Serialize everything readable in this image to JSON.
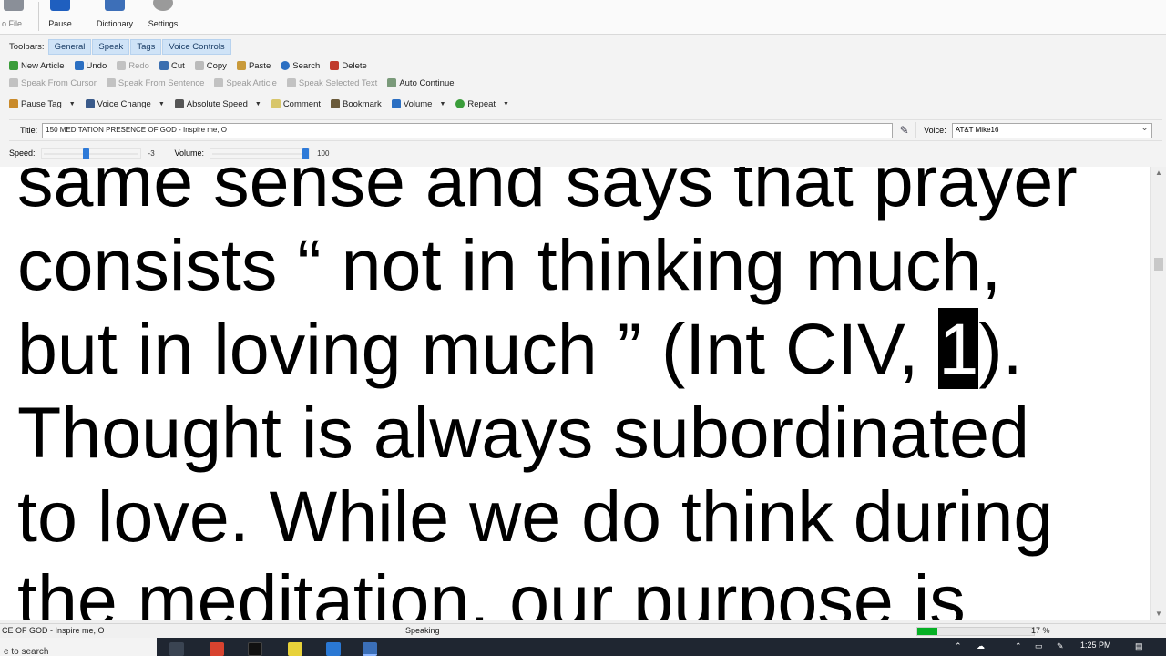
{
  "ribbon": {
    "items": [
      {
        "label": "o File",
        "icon": "save-icon"
      },
      {
        "label": "Pause",
        "icon": "pause-icon"
      },
      {
        "label": "Dictionary",
        "icon": "dictionary-icon"
      },
      {
        "label": "Settings",
        "icon": "gear-icon"
      }
    ]
  },
  "toolbars": {
    "label": "Toolbars:",
    "tabs": [
      "General",
      "Speak",
      "Tags",
      "Voice Controls"
    ],
    "row1": [
      {
        "label": "New Article",
        "icon": "new-article-icon",
        "color": "#3a9d3a"
      },
      {
        "label": "Undo",
        "icon": "undo-icon",
        "color": "#2b6fc2"
      },
      {
        "label": "Redo",
        "icon": "redo-icon",
        "color": "#888888",
        "disabled": true
      },
      {
        "label": "Cut",
        "icon": "scissors-icon",
        "color": "#3b6fb0"
      },
      {
        "label": "Copy",
        "icon": "copy-icon",
        "color": "#888888",
        "disabled": true
      },
      {
        "label": "Paste",
        "icon": "paste-icon",
        "color": "#c99a3a"
      },
      {
        "label": "Search",
        "icon": "search-icon",
        "color": "#2b6fc2"
      },
      {
        "label": "Delete",
        "icon": "delete-icon",
        "color": "#c0392b"
      }
    ],
    "row2": [
      {
        "label": "Speak From Cursor",
        "icon": "speak-cursor-icon",
        "disabled": true
      },
      {
        "label": "Speak From Sentence",
        "icon": "speak-sentence-icon",
        "disabled": true
      },
      {
        "label": "Speak Article",
        "icon": "speak-article-icon",
        "disabled": true
      },
      {
        "label": "Speak Selected Text",
        "icon": "speak-selection-icon",
        "disabled": true
      },
      {
        "label": "Auto Continue",
        "icon": "auto-continue-icon",
        "disabled": false
      }
    ],
    "row3": [
      {
        "label": "Pause Tag",
        "icon": "pause-tag-icon",
        "dropdown": true
      },
      {
        "label": "Voice Change",
        "icon": "voice-change-icon",
        "dropdown": true
      },
      {
        "label": "Absolute Speed",
        "icon": "speed-icon",
        "dropdown": true
      },
      {
        "label": "Comment",
        "icon": "comment-icon",
        "dropdown": false
      },
      {
        "label": "Bookmark",
        "icon": "bookmark-icon",
        "dropdown": false
      },
      {
        "label": "Volume",
        "icon": "volume-icon",
        "dropdown": true
      },
      {
        "label": "Repeat",
        "icon": "repeat-icon",
        "dropdown": true
      }
    ]
  },
  "title_field": {
    "label": "Title:",
    "value": "150 MEDITATION PRESENCE OF GOD - Inspire me, O"
  },
  "voice_field": {
    "label": "Voice:",
    "value": "AT&T Mike16"
  },
  "speed": {
    "label": "Speed:",
    "value": "-3",
    "level": 0.45
  },
  "volume": {
    "label": "Volume:",
    "value": "100",
    "level": 1.0
  },
  "document": {
    "lines": [
      "same sense and says that prayer",
      "consists “ not in thinking much,",
      "but in loving much ” (Int CIV, ",
      "Thought is always subordinated",
      "to love. While we do think during",
      "the meditation, our purpose is"
    ],
    "highlight": "1",
    "line3_tail": ")."
  },
  "status": {
    "left": "CE OF GOD - Inspire me, O",
    "state": "Speaking",
    "progress_percent": 17,
    "progress_label": "17 %"
  },
  "taskbar": {
    "search_placeholder": "e to search",
    "clock": "1:25 PM"
  },
  "colors": {
    "accent": "#2e7ad8",
    "tab_bg": "#cfe3f7",
    "progress": "#06b025",
    "highlight_bg": "#000000"
  }
}
